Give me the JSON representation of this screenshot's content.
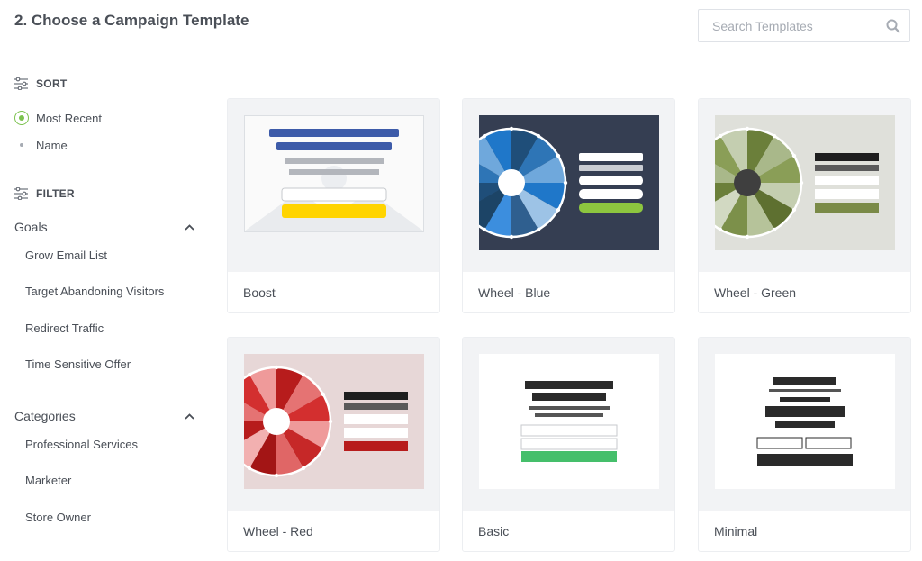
{
  "header": {
    "title": "2. Choose a Campaign Template"
  },
  "search": {
    "placeholder": "Search Templates",
    "icon": "search-icon"
  },
  "sort": {
    "heading": "SORT",
    "options": [
      {
        "label": "Most Recent",
        "selected": true
      },
      {
        "label": "Name",
        "selected": false
      }
    ]
  },
  "filter": {
    "heading": "FILTER",
    "goals": {
      "title": "Goals",
      "expanded": true,
      "items": [
        "Grow Email List",
        "Target Abandoning Visitors",
        "Redirect Traffic",
        "Time Sensitive Offer"
      ]
    },
    "categories": {
      "title": "Categories",
      "expanded": true,
      "items": [
        "Professional Services",
        "Marketer",
        "Store Owner"
      ]
    }
  },
  "templates": [
    {
      "name": "Boost"
    },
    {
      "name": "Wheel - Blue"
    },
    {
      "name": "Wheel - Green"
    },
    {
      "name": "Wheel - Red"
    },
    {
      "name": "Basic"
    },
    {
      "name": "Minimal"
    }
  ],
  "colors": {
    "accent_green": "#7cc24f",
    "text": "#4a4f57",
    "card_bg": "#f2f3f5",
    "boost_bar": "#3d5ba9",
    "boost_button": "#ffd400",
    "wheel_blue_bg": "#353e52",
    "wheel_green_bg": "#dfe0da",
    "wheel_red_bg": "#e7d7d7",
    "basic_button": "#45bf6b"
  }
}
